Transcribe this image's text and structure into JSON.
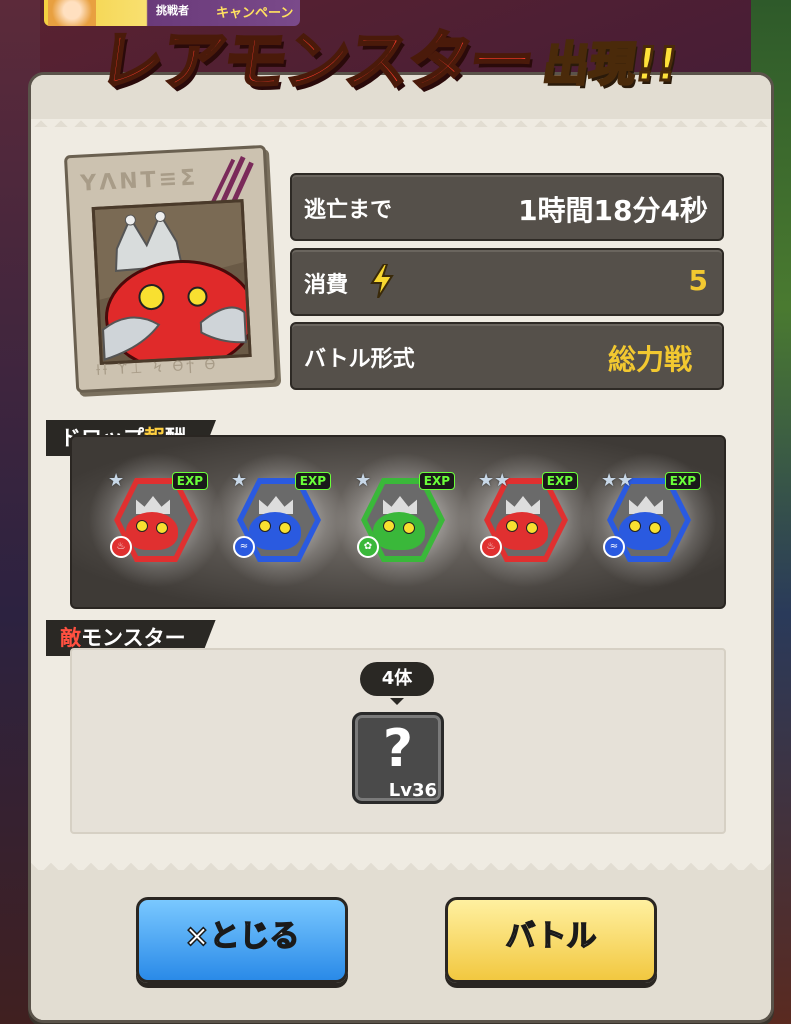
{
  "top_banner": {
    "label_left": "挑戦者",
    "label_right": "キャンペーン"
  },
  "title": {
    "main": "レアモンスター",
    "sub": "出現!!"
  },
  "poster": {
    "glyphs_top": "YΛNT≡Ʃ",
    "glyphs_bottom": "ƚƚ ϒ⊥ Ϟ ϴϯ ϴ"
  },
  "info": {
    "escape": {
      "label": "逃亡まで",
      "value": "1時間18分4秒"
    },
    "cost": {
      "label": "消費",
      "value": "5"
    },
    "battle_type": {
      "label": "バトル形式",
      "value": "総力戦"
    }
  },
  "drop_section": {
    "label_a": "ドロップ",
    "label_b": "報",
    "label_c": "酬"
  },
  "rewards": [
    {
      "exp": "EXP",
      "stars": "★",
      "color": "#e03030",
      "element": "fire"
    },
    {
      "exp": "EXP",
      "stars": "★",
      "color": "#2a5ae0",
      "element": "water"
    },
    {
      "exp": "EXP",
      "stars": "★",
      "color": "#3ab83a",
      "element": "wood"
    },
    {
      "exp": "EXP",
      "stars": "★★",
      "color": "#e03030",
      "element": "fire"
    },
    {
      "exp": "EXP",
      "stars": "★★",
      "color": "#2a5ae0",
      "element": "water"
    }
  ],
  "enemy_section": {
    "label_a": "敵",
    "label_b": "モンスター"
  },
  "enemy": {
    "count": "4体",
    "icon": "?",
    "level": "Lv36"
  },
  "buttons": {
    "close": "×とじる",
    "battle": "バトル"
  }
}
